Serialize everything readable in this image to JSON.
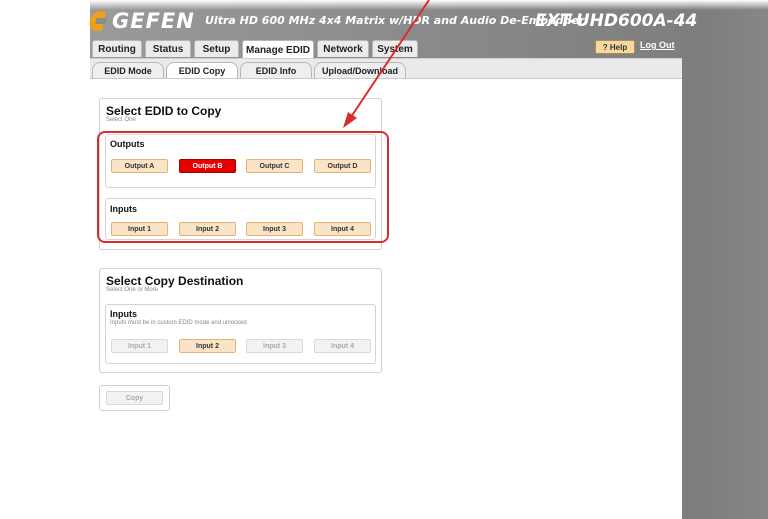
{
  "header": {
    "logo_text": "GEFEN",
    "product_title": "Ultra HD 600 MHz 4x4 Matrix w/HDR and Audio De-Embedder",
    "model": "EXT-UHD600A-44",
    "help_label": "? Help",
    "logout_label": "Log Out"
  },
  "main_tabs": [
    {
      "label": "Routing"
    },
    {
      "label": "Status"
    },
    {
      "label": "Setup"
    },
    {
      "label": "Manage EDID"
    },
    {
      "label": "Network"
    },
    {
      "label": "System"
    }
  ],
  "sub_tabs": [
    {
      "label": "EDID Mode"
    },
    {
      "label": "EDID Copy"
    },
    {
      "label": "EDID Info"
    },
    {
      "label": "Upload/Download"
    }
  ],
  "select_edid": {
    "title": "Select EDID to Copy",
    "subtitle": "Select One",
    "outputs_title": "Outputs",
    "outputs": [
      "Output A",
      "Output B",
      "Output C",
      "Output D"
    ],
    "inputs_title": "Inputs",
    "inputs": [
      "Input 1",
      "Input 2",
      "Input 3",
      "Input 4"
    ],
    "selected": "Output B"
  },
  "copy_destination": {
    "title": "Select Copy Destination",
    "subtitle": "Select One or More",
    "inputs_title": "Inputs",
    "inputs_note": "Inputs must be in custom EDID mode and unlocked",
    "inputs": [
      "Input 1",
      "Input 2",
      "Input 3",
      "Input 4"
    ],
    "enabled": "Input 2"
  },
  "copy_button": "Copy",
  "colors": {
    "selected": "#e60000",
    "button": "#fbe3c6",
    "annotation": "#d92c2c",
    "logo_accent": "#f0a11a"
  }
}
